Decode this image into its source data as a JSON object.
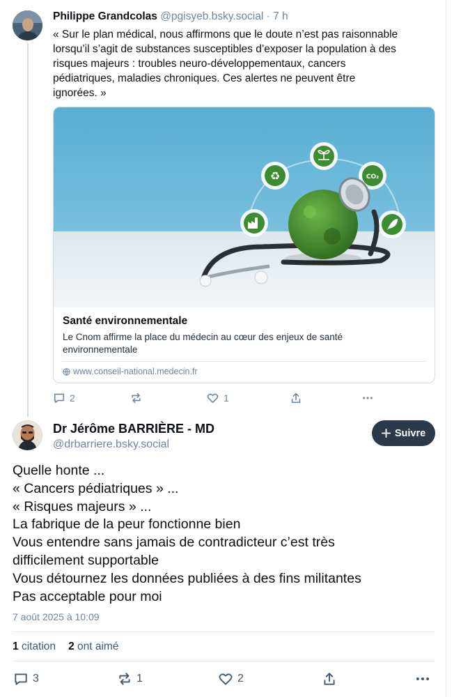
{
  "parent_post": {
    "author_name": "Philippe Grandcolas",
    "handle": "@pgisyeb.bsky.social",
    "separator": "·",
    "time": "7 h",
    "text_lines": [
      "« Sur le plan médical, nous affirmons que le doute n’est pas raisonnable",
      "lorsqu’il s’agit de substances susceptibles d’exposer la population à des",
      "risques majeurs : troubles neuro-développementaux, cancers",
      "pédiatriques, maladies chroniques. Ces alertes ne peuvent être",
      "ignorées. »"
    ],
    "link_card": {
      "title": "Santé environnementale",
      "description_lines": [
        "Le Cnom affirme la place du médecin au cœur des enjeux de santé",
        "environnementale"
      ],
      "domain": "www.conseil-national.medecin.fr",
      "image_icons": [
        "recycle-icon",
        "plant-hand-icon",
        "co2-cloud-icon",
        "factory-icon",
        "leaf-icon"
      ],
      "image_colors": {
        "sky": "#5eb3d6",
        "table": "#e8eef1",
        "globe": "#3f8a2c"
      }
    },
    "actions": {
      "replies": "2",
      "reposts": "",
      "likes": "1"
    }
  },
  "reply_post": {
    "author_name": "Dr Jérôme BARRIÈRE - MD",
    "handle": "@drbarriere.bsky.social",
    "follow_label": "Suivre",
    "text_lines": [
      "Quelle honte ...",
      "« Cancers pédiatriques » ...",
      "« Risques majeurs » ...",
      "La fabrique de la peur fonctionne bien",
      "Vous entendre sans jamais de contradicteur c’est très",
      "difficilement supportable",
      "Vous détournez les données publiées à des fins militantes",
      "Pas acceptable pour moi"
    ],
    "date": "7 août 2025 à 10:09",
    "stats": {
      "quotes_count": "1",
      "quotes_label": "citation",
      "likes_count": "2",
      "likes_label": "ont aimé"
    },
    "actions": {
      "replies": "3",
      "reposts": "1",
      "likes": "2"
    }
  },
  "colors": {
    "accent_dark": "#2a3a4b",
    "muted": "#6f869f",
    "border": "#d4dbe2"
  }
}
